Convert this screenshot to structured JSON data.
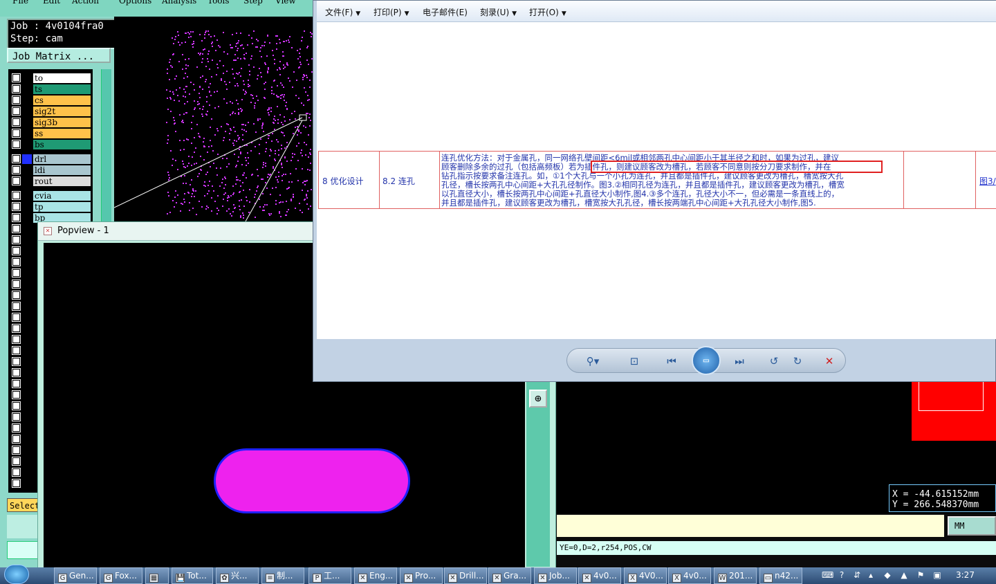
{
  "genesis": {
    "menu_partial": [
      "File",
      "Edit",
      "Action",
      "Options",
      "Analysis",
      "Tools",
      "Step",
      "View"
    ],
    "job_label": "Job : 4v0104fra0",
    "step_label": "Step: cam",
    "job_matrix_button": "Job Matrix ...",
    "layers": [
      {
        "name": "to",
        "color": "#ffffff"
      },
      {
        "name": "ts",
        "color": "#1f9a74"
      },
      {
        "name": "cs",
        "color": "#ffc24a"
      },
      {
        "name": "sig2t",
        "color": "#ffc24a"
      },
      {
        "name": "sig3b",
        "color": "#ffc24a"
      },
      {
        "name": "ss",
        "color": "#ffc24a"
      },
      {
        "name": "bs",
        "color": "#1f9a74"
      },
      {
        "name": "drl",
        "color": "#a9c6cf"
      },
      {
        "name": "ldi",
        "color": "#a9c6cf"
      },
      {
        "name": "rout",
        "color": "#dcdcdc"
      },
      {
        "name": "cvia",
        "color": "#a9e4e6"
      },
      {
        "name": "tp",
        "color": "#a9e4e6"
      },
      {
        "name": "bp",
        "color": "#a9e4e6"
      }
    ],
    "select_button": "Select",
    "coord_x": "X = -44.615152mm",
    "coord_y": "Y = 266.548370mm",
    "units": "MM",
    "command_line": "YE=0,D=2,r254,POS,CW"
  },
  "popview": {
    "title": "Popview - 1"
  },
  "viewer": {
    "menu": [
      {
        "label": "文件(F)",
        "caret": true
      },
      {
        "label": "打印(P)",
        "caret": true
      },
      {
        "label": "电子邮件(E)",
        "caret": false
      },
      {
        "label": "刻录(U)",
        "caret": true
      },
      {
        "label": "打开(O)",
        "caret": true
      }
    ],
    "row": {
      "index_col": "8 优化设计",
      "section_col": "8.2 连孔",
      "text_lines": [
        "连孔优化方法：对于金属孔，同一网络孔壁间距<6mil或相邻两孔中心间距小于其半径之和时，如果为过孔，建议",
        "顾客删除多余的过孔（包括高频板）若为插件孔，则建议顾客改为槽孔，若顾客不同意则按分刀要求制作，并在",
        "钻孔指示按要求备注连孔。如，①1个大孔与一个小孔为连孔，并且都是插件孔，建议顾客更改为槽孔，槽宽按大孔",
        "孔径，槽长按两孔中心间距+大孔孔径制作。图3.②相同孔径为连孔，并且都是插件孔，建议顾客更改为槽孔，槽宽",
        "以孔直径大小，槽长按两孔中心间距+孔直径大小制作,图4.③多个连孔，孔径大小不一，但必需是一条直线上的，",
        "并且都是插件孔，建议顾客更改为槽孔，槽宽按大孔孔径，槽长按两端孔中心间距+大孔孔径大小制作,图5."
      ],
      "figure_link": "图3/"
    },
    "toolbar": [
      "zoom",
      "fit",
      "prev",
      "slideshow",
      "next",
      "rotate-left",
      "rotate-right",
      "delete"
    ]
  },
  "taskbar": {
    "items": [
      {
        "label": "Gen...",
        "icon": "G"
      },
      {
        "label": "Fox...",
        "icon": "G"
      },
      {
        "label": "",
        "icon": "▦"
      },
      {
        "label": "Tot...",
        "icon": "💾"
      },
      {
        "label": "兴...",
        "icon": "✿"
      },
      {
        "label": "制...",
        "icon": "≡"
      },
      {
        "label": "工...",
        "icon": "P"
      },
      {
        "label": "Eng...",
        "icon": "✕"
      },
      {
        "label": "Pro...",
        "icon": "✕"
      },
      {
        "label": "Drill...",
        "icon": "✕"
      },
      {
        "label": "Gra...",
        "icon": "✕"
      },
      {
        "label": "Job...",
        "icon": "✕"
      },
      {
        "label": "4v0...",
        "icon": "✕"
      },
      {
        "label": "4V0...",
        "icon": "X"
      },
      {
        "label": "4v0...",
        "icon": "X"
      },
      {
        "label": "201...",
        "icon": "W"
      },
      {
        "label": "n42...",
        "icon": "▭"
      }
    ],
    "clock": "3:27"
  },
  "colors": {
    "accent_teal": "#8ed9c9",
    "highlight_red": "#e02020",
    "popview_shape": "#ee22ee"
  }
}
